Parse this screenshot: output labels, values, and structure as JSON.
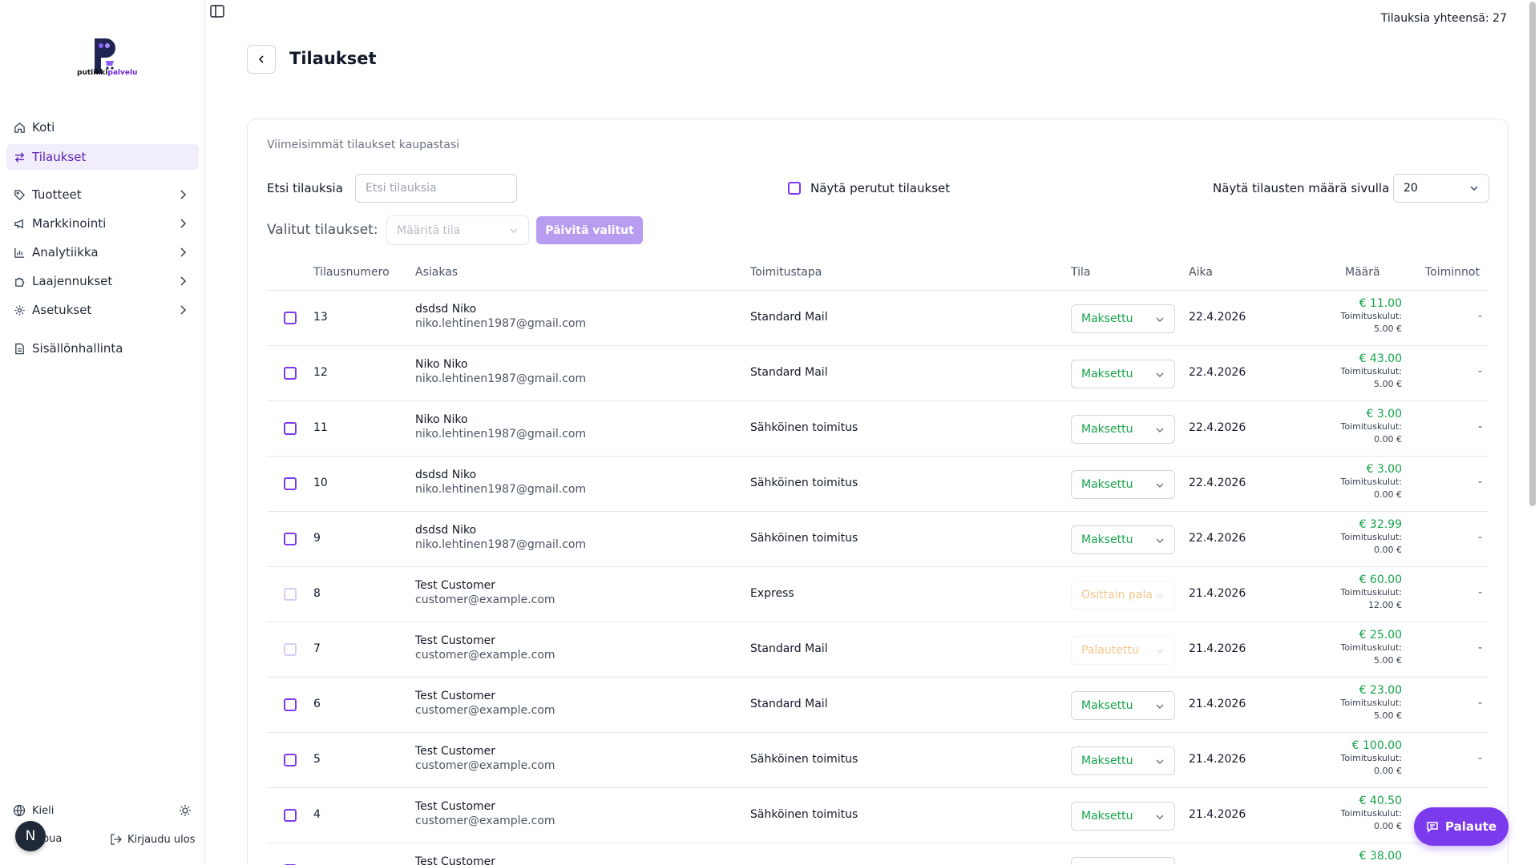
{
  "brand": {
    "logo_text_a": "putiikki",
    "logo_text_b": "palvelu",
    "accent": "#7c3aed"
  },
  "sidebar": {
    "items": [
      {
        "label": "Koti",
        "icon": "home-icon"
      },
      {
        "label": "Tilaukset",
        "icon": "swap-icon"
      },
      {
        "label": "Tuotteet",
        "icon": "tag-icon"
      },
      {
        "label": "Markkinointi",
        "icon": "megaphone-icon"
      },
      {
        "label": "Analytiikka",
        "icon": "bar-chart-icon"
      },
      {
        "label": "Laajennukset",
        "icon": "puzzle-icon"
      },
      {
        "label": "Asetukset",
        "icon": "gear-icon"
      },
      {
        "label": "Sisällönhallinta",
        "icon": "document-icon"
      }
    ],
    "language_label": "Kieli",
    "help_label": "Apua",
    "logout_label": "Kirjaudu ulos",
    "avatar_initial": "N"
  },
  "header": {
    "total_orders": "Tilauksia yhteensä: 27",
    "title": "Tilaukset"
  },
  "card": {
    "subtitle": "Viimeisimmät tilaukset kaupastasi",
    "search_label": "Etsi tilauksia",
    "search_placeholder": "Etsi tilauksia",
    "show_cancelled_label": "Näytä perutut tilaukset",
    "per_page_label": "Näytä tilausten määrä sivulla",
    "per_page_value": "20",
    "selected_label": "Valitut tilaukset:",
    "assign_status_placeholder": "Määritä tila",
    "update_button": "Päivitä valitut"
  },
  "table": {
    "columns": [
      "Tilausnumero",
      "Asiakas",
      "Toimitustapa",
      "Tila",
      "Aika",
      "Määrä",
      "Toiminnot"
    ],
    "shipping_prefix": "Toimituskulut:",
    "rows": [
      {
        "num": "13",
        "name": "dsdsd Niko",
        "email": "niko.lehtinen1987@gmail.com",
        "method": "Standard Mail",
        "status": "Maksettu",
        "status_color": "#16a34a",
        "date": "22.4.2026",
        "amount": "€ 11.00",
        "shipping": "5.00 €",
        "action": "-",
        "disabled": false
      },
      {
        "num": "12",
        "name": "Niko Niko",
        "email": "niko.lehtinen1987@gmail.com",
        "method": "Standard Mail",
        "status": "Maksettu",
        "status_color": "#16a34a",
        "date": "22.4.2026",
        "amount": "€ 43.00",
        "shipping": "5.00 €",
        "action": "-",
        "disabled": false
      },
      {
        "num": "11",
        "name": "Niko Niko",
        "email": "niko.lehtinen1987@gmail.com",
        "method": "Sähköinen toimitus",
        "status": "Maksettu",
        "status_color": "#16a34a",
        "date": "22.4.2026",
        "amount": "€ 3.00",
        "shipping": "0.00 €",
        "action": "-",
        "disabled": false
      },
      {
        "num": "10",
        "name": "dsdsd Niko",
        "email": "niko.lehtinen1987@gmail.com",
        "method": "Sähköinen toimitus",
        "status": "Maksettu",
        "status_color": "#16a34a",
        "date": "22.4.2026",
        "amount": "€ 3.00",
        "shipping": "0.00 €",
        "action": "-",
        "disabled": false
      },
      {
        "num": "9",
        "name": "dsdsd Niko",
        "email": "niko.lehtinen1987@gmail.com",
        "method": "Sähköinen toimitus",
        "status": "Maksettu",
        "status_color": "#16a34a",
        "date": "22.4.2026",
        "amount": "€ 32.99",
        "shipping": "0.00 €",
        "action": "-",
        "disabled": false
      },
      {
        "num": "8",
        "name": "Test Customer",
        "email": "customer@example.com",
        "method": "Express",
        "status": "Osittain pala",
        "status_color": "#f3c58a",
        "date": "21.4.2026",
        "amount": "€ 60.00",
        "shipping": "12.00 €",
        "action": "-",
        "disabled": true
      },
      {
        "num": "7",
        "name": "Test Customer",
        "email": "customer@example.com",
        "method": "Standard Mail",
        "status": "Palautettu",
        "status_color": "#f3c58a",
        "date": "21.4.2026",
        "amount": "€ 25.00",
        "shipping": "5.00 €",
        "action": "-",
        "disabled": true
      },
      {
        "num": "6",
        "name": "Test Customer",
        "email": "customer@example.com",
        "method": "Standard Mail",
        "status": "Maksettu",
        "status_color": "#16a34a",
        "date": "21.4.2026",
        "amount": "€ 23.00",
        "shipping": "5.00 €",
        "action": "-",
        "disabled": false
      },
      {
        "num": "5",
        "name": "Test Customer",
        "email": "customer@example.com",
        "method": "Sähköinen toimitus",
        "status": "Maksettu",
        "status_color": "#16a34a",
        "date": "21.4.2026",
        "amount": "€ 100.00",
        "shipping": "0.00 €",
        "action": "-",
        "disabled": false
      },
      {
        "num": "4",
        "name": "Test Customer",
        "email": "customer@example.com",
        "method": "Sähköinen toimitus",
        "status": "Maksettu",
        "status_color": "#16a34a",
        "date": "21.4.2026",
        "amount": "€ 40.50",
        "shipping": "0.00 €",
        "action": "-",
        "disabled": false
      },
      {
        "num": "",
        "name": "Test Customer",
        "email": "",
        "method": "",
        "status": "",
        "status_color": "#16a34a",
        "date": "",
        "amount": "€ 38.00",
        "shipping": "",
        "action": "",
        "disabled": false
      }
    ]
  },
  "feedback_button": "Palaute"
}
